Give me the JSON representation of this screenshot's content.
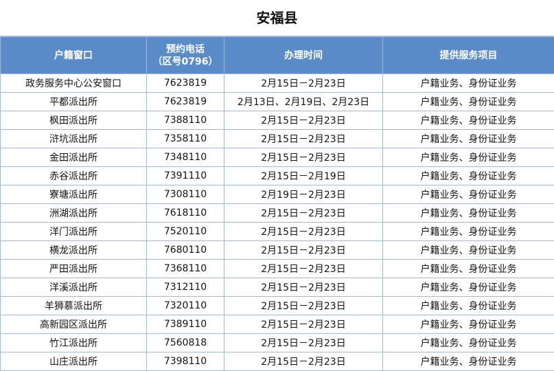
{
  "title": "安福县",
  "header": {
    "col1": "户籍窗口",
    "col2_line1": "预约电话",
    "col2_line2": "（区号0796）",
    "col3": "办理时间",
    "col4": "提供服务项目"
  },
  "rows": [
    {
      "name": "政务服务中心公安窗口",
      "phone": "7623819",
      "time": "2月15日－2月23日",
      "service": "户籍业务、身份证业务"
    },
    {
      "name": "平都派出所",
      "phone": "7623819",
      "time": "2月13日、2月19日、2月23日",
      "service": "户籍业务、身份证业务"
    },
    {
      "name": "枫田派出所",
      "phone": "7388110",
      "time": "2月15日－2月23日",
      "service": "户籍业务、身份证业务"
    },
    {
      "name": "浒坑派出所",
      "phone": "7358110",
      "time": "2月15日－2月23日",
      "service": "户籍业务、身份证业务"
    },
    {
      "name": "金田派出所",
      "phone": "7348110",
      "time": "2月15日－2月23日",
      "service": "户籍业务、身份证业务"
    },
    {
      "name": "赤谷派出所",
      "phone": "7391110",
      "time": "2月15日－2月19日",
      "service": "户籍业务、身份证业务"
    },
    {
      "name": "寮塘派出所",
      "phone": "7308110",
      "time": "2月19日－2月23日",
      "service": "户籍业务、身份证业务"
    },
    {
      "name": "洲湖派出所",
      "phone": "7618110",
      "time": "2月15日－2月23日",
      "service": "户籍业务、身份证业务"
    },
    {
      "name": "洋门派出所",
      "phone": "7520110",
      "time": "2月15日－2月23日",
      "service": "户籍业务、身份证业务"
    },
    {
      "name": "横龙派出所",
      "phone": "7680110",
      "time": "2月15日－2月23日",
      "service": "户籍业务、身份证业务"
    },
    {
      "name": "严田派出所",
      "phone": "7368110",
      "time": "2月15日－2月23日",
      "service": "户籍业务、身份证业务"
    },
    {
      "name": "洋溪派出所",
      "phone": "7312110",
      "time": "2月15日－2月23日",
      "service": "户籍业务、身份证业务"
    },
    {
      "name": "羊狮慕派出所",
      "phone": "7320110",
      "time": "2月15日－2月23日",
      "service": "户籍业务、身份证业务"
    },
    {
      "name": "高新园区派出所",
      "phone": "7389110",
      "time": "2月15日－2月23日",
      "service": "户籍业务、身份证业务"
    },
    {
      "name": "竹江派出所",
      "phone": "7560818",
      "time": "2月15日－2月23日",
      "service": "户籍业务、身份证业务"
    },
    {
      "name": "山庄派出所",
      "phone": "7398110",
      "time": "2月15日－2月23日",
      "service": "户籍业务、身份证业务"
    }
  ]
}
